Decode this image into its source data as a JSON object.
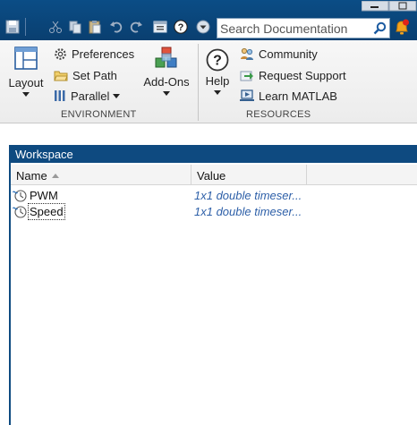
{
  "search": {
    "placeholder": "Search Documentation"
  },
  "ribbon": {
    "environment": {
      "label": "ENVIRONMENT",
      "layout": "Layout",
      "preferences": "Preferences",
      "set_path": "Set Path",
      "parallel": "Parallel",
      "add_ons": "Add-Ons"
    },
    "resources": {
      "label": "RESOURCES",
      "help": "Help",
      "community": "Community",
      "request_support": "Request Support",
      "learn_matlab": "Learn MATLAB"
    }
  },
  "workspace": {
    "title": "Workspace",
    "columns": {
      "name": "Name",
      "value": "Value"
    },
    "rows": [
      {
        "name": "PWM",
        "value": "1x1 double timeser..."
      },
      {
        "name": "Speed",
        "value": "1x1 double timeser..."
      }
    ]
  },
  "colors": {
    "title_bar": "#0e4a80",
    "toolbar": "#0b4d86",
    "value_text": "#2d5fa8"
  },
  "icons": [
    "save-icon",
    "cut-icon",
    "copy-icon",
    "paste-icon",
    "undo-icon",
    "redo-icon",
    "switch-windows-icon",
    "help-icon",
    "quick-access-menu-icon",
    "search-icon",
    "notification-bell-icon",
    "timeseries-icon"
  ]
}
